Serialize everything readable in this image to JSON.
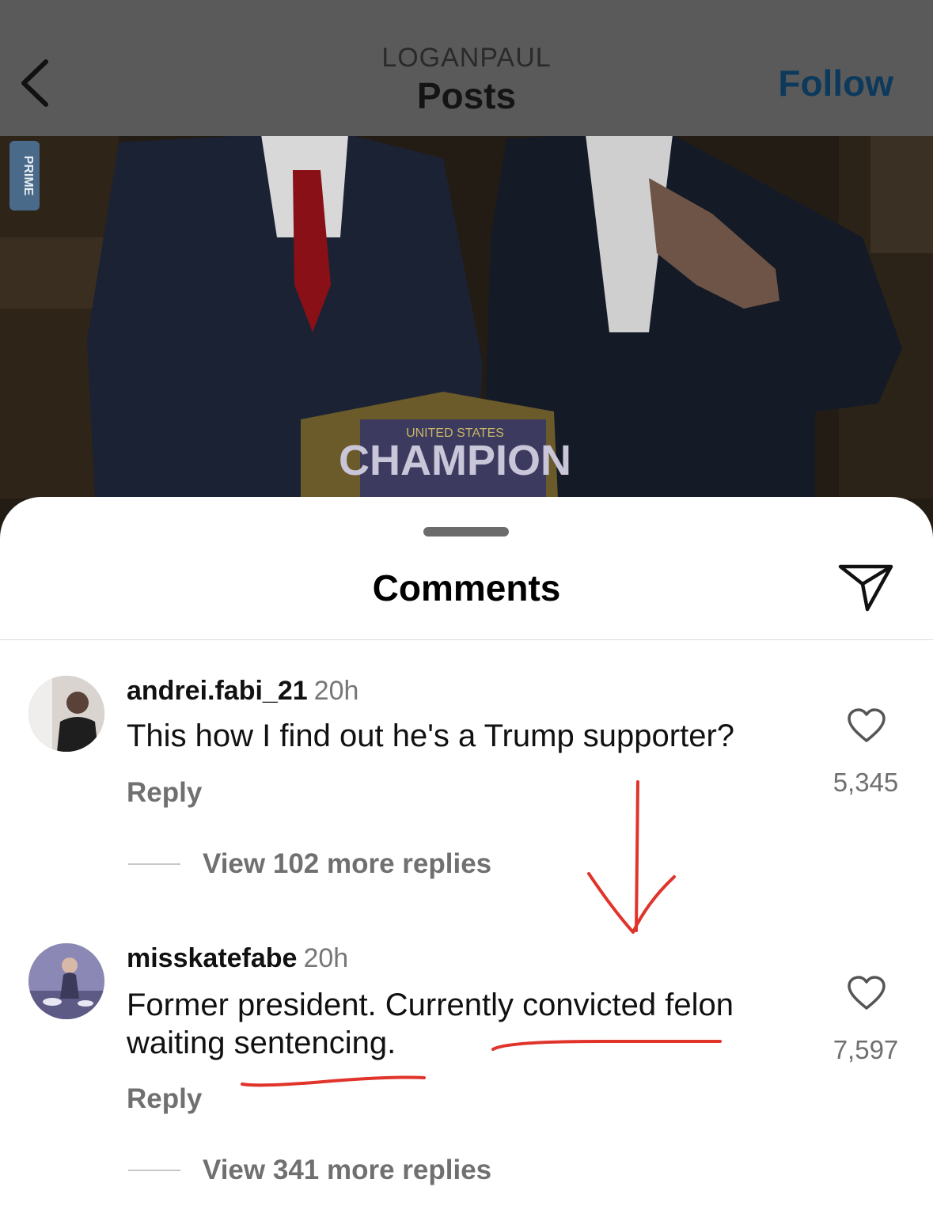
{
  "header": {
    "account": "LOGANPAUL",
    "title": "Posts",
    "follow_label": "Follow"
  },
  "sheet": {
    "title": "Comments"
  },
  "comments": [
    {
      "username": "andrei.fabi_21",
      "time": "20h",
      "text": "This how I find out he's a Trump supporter?",
      "reply_label": "Reply",
      "likes": "5,345",
      "more_replies": "View 102 more replies"
    },
    {
      "username": "misskatefabe",
      "time": "20h",
      "text_line1": "Former president. Currently convicted felon",
      "text_line2": "waiting sentencing.",
      "reply_label": "Reply",
      "likes": "7,597",
      "more_replies": "View 341 more replies"
    }
  ],
  "photo": {
    "belt_text": "CHAMPION",
    "belt_subtext": "UNITED STATES",
    "can_text": "PRIME"
  },
  "colors": {
    "follow": "#0d3a5c",
    "annotation": "#e0342b",
    "secondary_text": "#707070"
  }
}
